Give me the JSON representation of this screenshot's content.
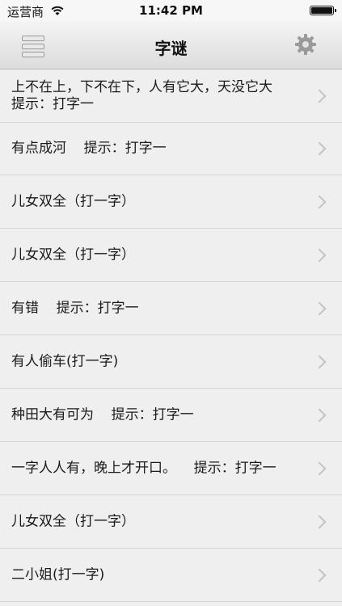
{
  "status_bar": {
    "carrier": "运营商",
    "time": "11:42 PM",
    "wifi_icon": "wifi-icon",
    "battery_icon": "battery-icon"
  },
  "nav_bar": {
    "title": "字谜",
    "menu_icon": "menu-icon",
    "settings_icon": "gear-icon"
  },
  "riddles": [
    {
      "text": "上不在上，下不在下，人有它大，天没它大\n提示：打字一"
    },
    {
      "text": "有点成河    提示：打字一"
    },
    {
      "text": "儿女双全（打一字）"
    },
    {
      "text": "儿女双全（打一字）"
    },
    {
      "text": "有错    提示：打字一"
    },
    {
      "text": "有人偷车(打一字)"
    },
    {
      "text": "种田大有可为    提示：打字一"
    },
    {
      "text": "一字人人有，晚上才开口。    提示：打字一"
    },
    {
      "text": "儿女双全（打一字）"
    },
    {
      "text": "二小姐(打一字)"
    }
  ]
}
